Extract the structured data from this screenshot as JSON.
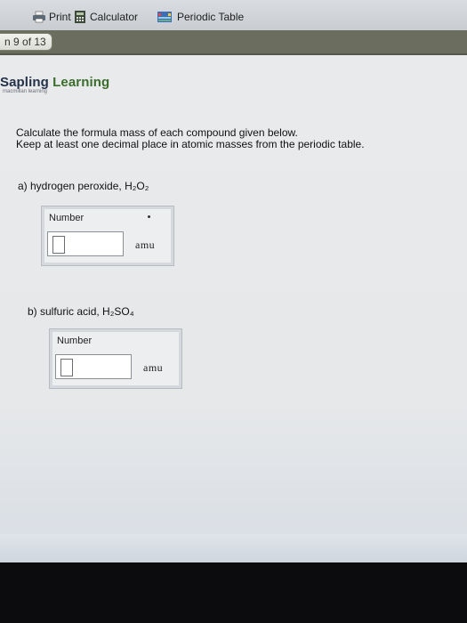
{
  "toolbar": {
    "print_label": "Print",
    "calculator_label": "Calculator",
    "periodic_label": "Periodic Table"
  },
  "pager": {
    "label": "n 9 of 13"
  },
  "brand": {
    "name_part1": "Sapling ",
    "name_part2": "Learning",
    "subtitle": "macmillan learning"
  },
  "instructions": {
    "line1": "Calculate the formula mass of each compound given below.",
    "line2": "Keep at least one decimal place in atomic masses from the periodic table."
  },
  "questions": [
    {
      "label": "a) hydrogen peroxide, H₂O₂",
      "field_label": "Number",
      "value": "",
      "unit": "amu"
    },
    {
      "label": "b) sulfuric acid, H₂SO₄",
      "field_label": "Number",
      "value": "",
      "unit": "amu"
    }
  ],
  "colors": {
    "pager_bar": "#6b6e5f",
    "brand_blue": "#23324a",
    "brand_green": "#3a6e2c"
  }
}
